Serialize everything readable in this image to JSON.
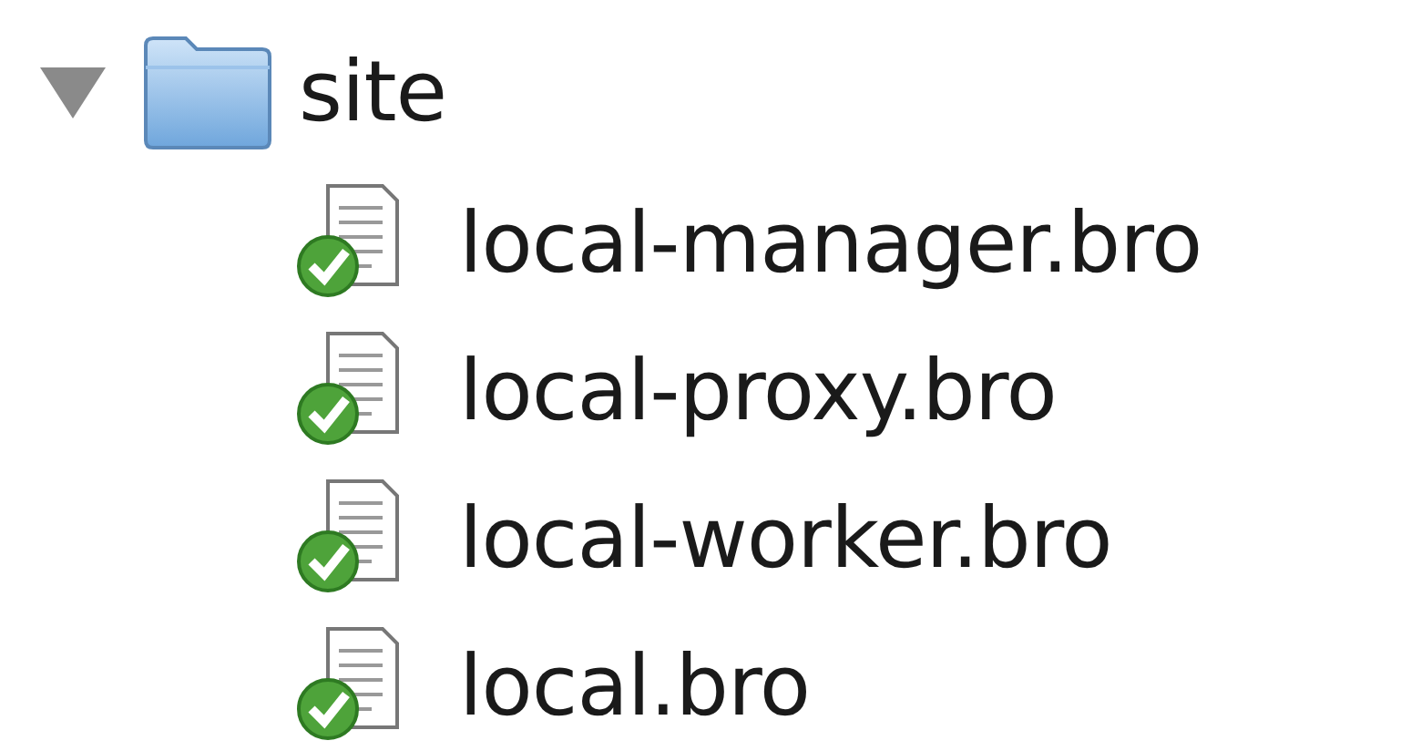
{
  "tree": [
    {
      "label": "site",
      "kind": "folder",
      "expanded": true,
      "children": [
        {
          "label": "local-manager.bro",
          "kind": "file"
        },
        {
          "label": "local-proxy.bro",
          "kind": "file"
        },
        {
          "label": "local-worker.bro",
          "kind": "file"
        },
        {
          "label": "local.bro",
          "kind": "file"
        }
      ]
    }
  ]
}
